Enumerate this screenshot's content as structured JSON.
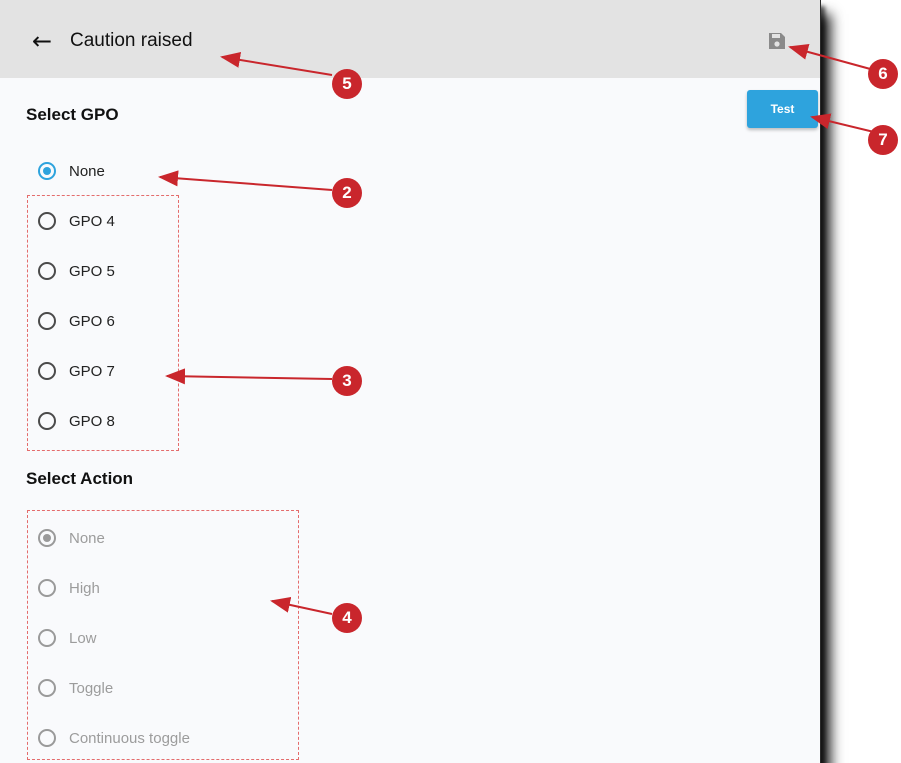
{
  "header": {
    "back_icon": "arrow-left-icon",
    "title": "Caution raised",
    "save_icon": "floppy-disk-icon"
  },
  "test_button": {
    "label": "Test",
    "color": "#2ea3dd"
  },
  "gpo_section": {
    "title": "Select GPO",
    "options": [
      {
        "label": "None",
        "checked": true
      },
      {
        "label": "GPO 4",
        "checked": false
      },
      {
        "label": "GPO 5",
        "checked": false
      },
      {
        "label": "GPO 6",
        "checked": false
      },
      {
        "label": "GPO 7",
        "checked": false
      },
      {
        "label": "GPO 8",
        "checked": false
      }
    ]
  },
  "action_section": {
    "title": "Select Action",
    "disabled": true,
    "options": [
      {
        "label": "None",
        "checked": true
      },
      {
        "label": "High",
        "checked": false
      },
      {
        "label": "Low",
        "checked": false
      },
      {
        "label": "Toggle",
        "checked": false
      },
      {
        "label": "Continuous toggle",
        "checked": false
      }
    ]
  },
  "callouts": [
    "2",
    "3",
    "4",
    "5",
    "6",
    "7"
  ],
  "annotation_color": "#c9262c"
}
